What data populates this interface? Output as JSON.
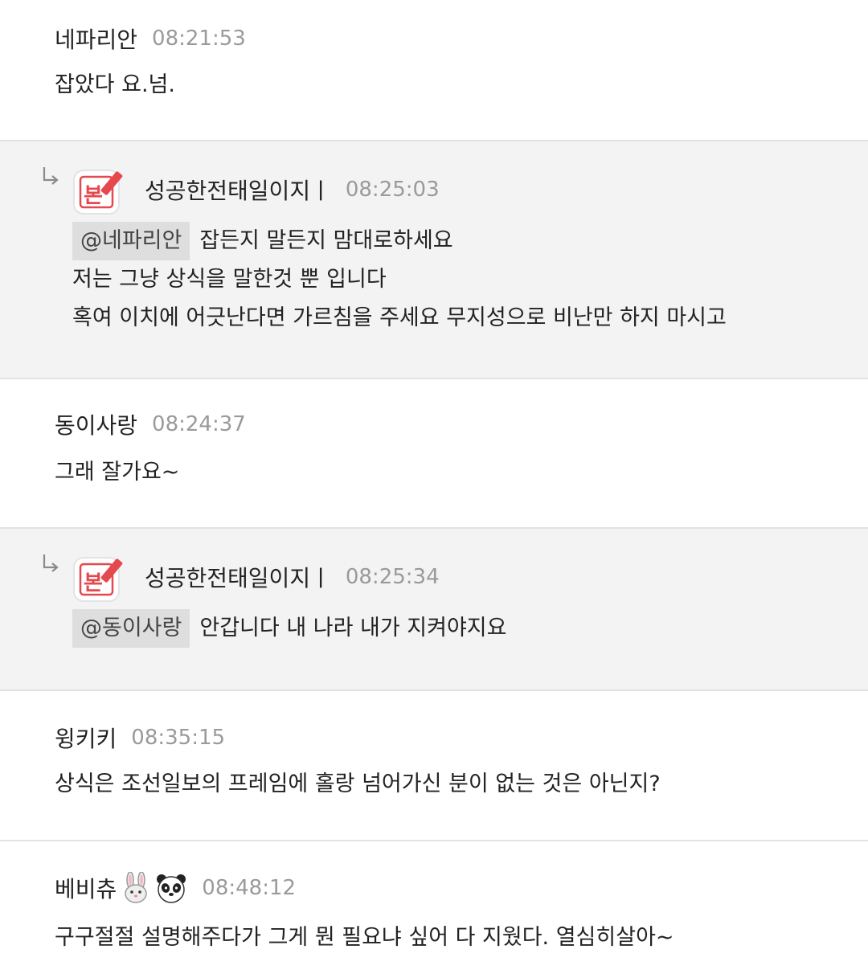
{
  "comments": [
    {
      "nickname": "네파리안",
      "time": "08:21:53",
      "lines": [
        "잡았다 요.넘."
      ]
    },
    {
      "nickname": "성공한전태일이지ㅣ",
      "time": "08:25:03",
      "badge_icon": "author-badge-icon",
      "mention": "@네파리안",
      "lines": [
        "잡든지 말든지 맘대로하세요",
        "저는 그냥 상식을 말한것 뿐 입니다",
        "혹여 이치에 어긋난다면 가르침을 주세요 무지성으로 비난만 하지 마시고"
      ]
    },
    {
      "nickname": "동이사랑",
      "time": "08:24:37",
      "lines": [
        "그래 잘가요~"
      ]
    },
    {
      "nickname": "성공한전태일이지ㅣ",
      "time": "08:25:34",
      "badge_icon": "author-badge-icon",
      "mention": "@동이사랑",
      "lines": [
        "안갑니다 내 나라 내가 지켜야지요"
      ]
    },
    {
      "nickname": "윙키키",
      "time": "08:35:15",
      "lines": [
        "상식은 조선일보의 프레임에 홀랑 넘어가신 분이 없는 것은 아닌지?"
      ]
    },
    {
      "nickname": "베비츄",
      "nickname_icons": [
        "rabbit-icon",
        "panda-icon"
      ],
      "time": "08:48:12",
      "lines": [
        "구구절절 설명해주다가 그게 뭔 필요냐 싶어 다 지웠다. 열심히살아~"
      ]
    }
  ],
  "colors": {
    "reply_background": "#f3f3f3",
    "divider": "#e2e2e2",
    "badge_red": "#e5484d",
    "mention_background": "#dedede",
    "timestamp": "#9a9a9a"
  }
}
